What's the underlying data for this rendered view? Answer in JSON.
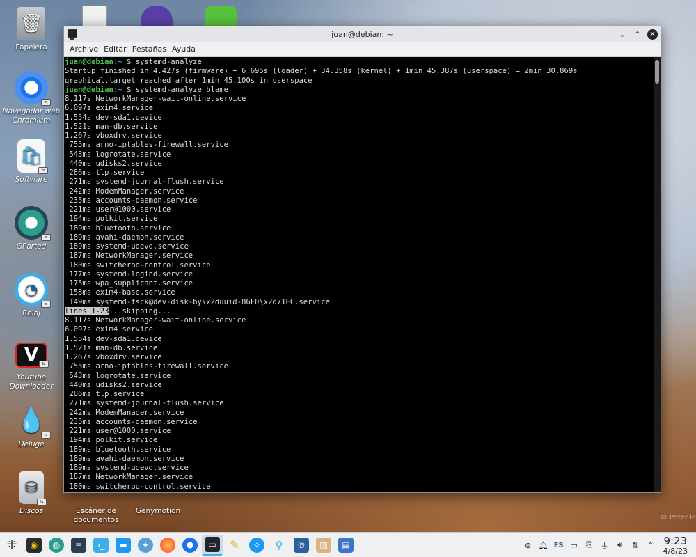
{
  "desktop": {
    "icons": [
      {
        "label": "Papelera"
      },
      {
        "label": "Navegador web Chromium"
      },
      {
        "label": "Software"
      },
      {
        "label": "GParted"
      },
      {
        "label": "Reloj"
      },
      {
        "label": "Youtube Downloader"
      },
      {
        "label": "Deluge"
      },
      {
        "label": "Discos"
      },
      {
        "label": "Escáner de documentos"
      },
      {
        "label": "Genymotion"
      }
    ]
  },
  "window": {
    "title": "juan@debian: ~",
    "menu": [
      "Archivo",
      "Editar",
      "Pestañas",
      "Ayuda"
    ]
  },
  "terminal": {
    "prompt_user": "juan@debian",
    "prompt_path": ":~",
    "cmd1": "$ systemd-analyze",
    "out1": "Startup finished in 4.427s (firmware) + 6.695s (loader) + 34.358s (kernel) + 1min 45.387s (userspace) = 2min 30.869s",
    "out2": "graphical.target reached after 1min 45.100s in userspace",
    "cmd2": "$ systemd-analyze blame",
    "blame": [
      "8.117s NetworkManager-wait-online.service",
      "6.097s exim4.service",
      "1.554s dev-sda1.device",
      "1.521s man-db.service",
      "1.267s vboxdrv.service",
      " 755ms arno-iptables-firewall.service",
      " 543ms logrotate.service",
      " 440ms udisks2.service",
      " 286ms tlp.service",
      " 271ms systemd-journal-flush.service",
      " 242ms ModemManager.service",
      " 235ms accounts-daemon.service",
      " 221ms user@1000.service",
      " 194ms polkit.service",
      " 189ms bluetooth.service",
      " 189ms avahi-daemon.service",
      " 189ms systemd-udevd.service",
      " 187ms NetworkManager.service",
      " 180ms switcheroo-control.service",
      " 177ms systemd-logind.service",
      " 175ms wpa_supplicant.service",
      " 158ms exim4-base.service",
      " 149ms systemd-fsck@dev-disk-by\\x2duuid-86F0\\x2d71EC.service"
    ],
    "pager_status": "lines 1-23",
    "pager_rest": "...skipping...",
    "blame2": [
      "8.117s NetworkManager-wait-online.service",
      "6.097s exim4.service",
      "1.554s dev-sda1.device",
      "1.521s man-db.service",
      "1.267s vboxdrv.service",
      " 755ms arno-iptables-firewall.service",
      " 543ms logrotate.service",
      " 440ms udisks2.service",
      " 286ms tlp.service",
      " 271ms systemd-journal-flush.service",
      " 242ms ModemManager.service",
      " 235ms accounts-daemon.service",
      " 221ms user@1000.service",
      " 194ms polkit.service",
      " 189ms bluetooth.service",
      " 189ms avahi-daemon.service",
      " 189ms systemd-udevd.service",
      " 187ms NetworkManager.service",
      " 180ms switcheroo-control.service"
    ]
  },
  "taskbar": {
    "keyboard_layout": "ES",
    "time": "9:23",
    "date": "4/8/23"
  },
  "watermark": "© Peter le"
}
